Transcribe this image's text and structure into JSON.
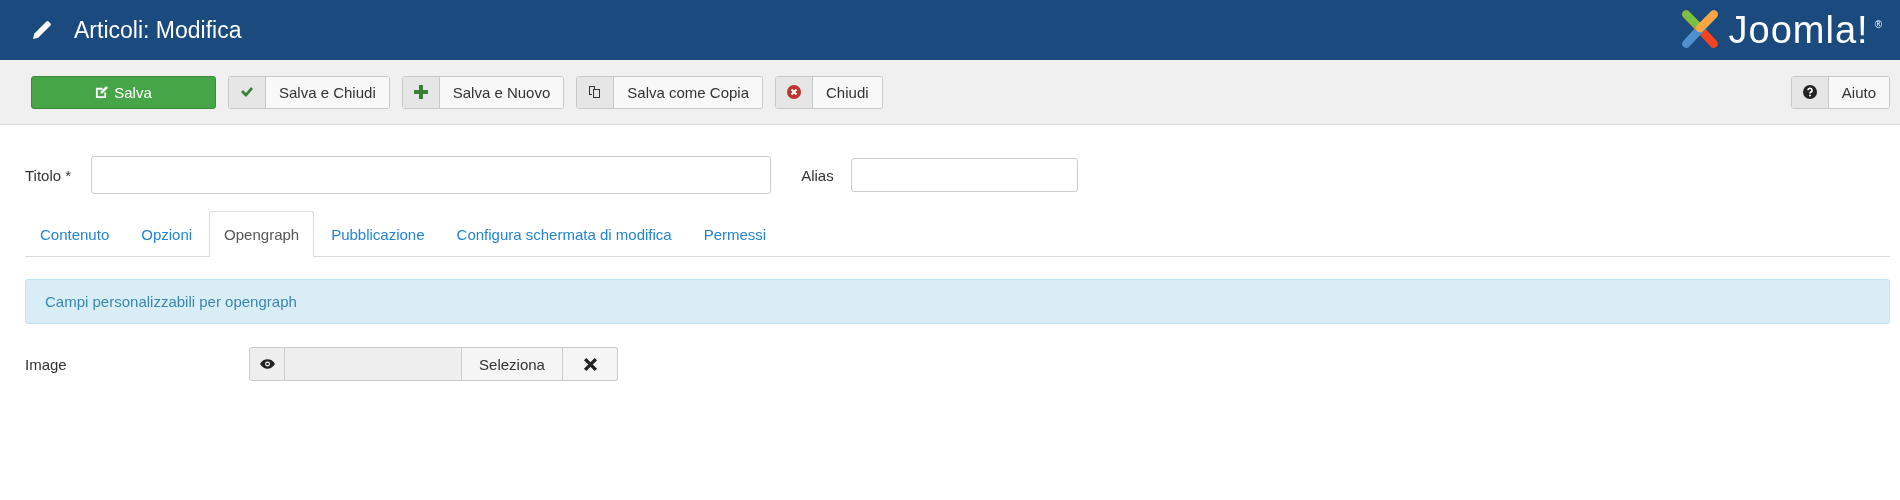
{
  "header": {
    "title": "Articoli: Modifica",
    "logo_text": "Joomla!",
    "logo_mark": "®"
  },
  "toolbar": {
    "buttons": [
      {
        "kind": "save",
        "label": "Salva"
      },
      {
        "kind": "save-close",
        "label": "Salva e Chiudi"
      },
      {
        "kind": "save-new",
        "label": "Salva e Nuovo"
      },
      {
        "kind": "save-copy",
        "label": "Salva come Copia"
      },
      {
        "kind": "close",
        "label": "Chiudi"
      }
    ],
    "help": {
      "kind": "help",
      "label": "Aiuto"
    }
  },
  "form": {
    "title_label": "Titolo *",
    "alias_label": "Alias"
  },
  "tabs": [
    {
      "label": "Contenuto",
      "selected": false
    },
    {
      "label": "Opzioni",
      "selected": false
    },
    {
      "label": "Opengraph",
      "selected": true
    },
    {
      "label": "Pubblicazione",
      "selected": false
    },
    {
      "label": "Configura schermata di modifica",
      "selected": false
    },
    {
      "label": "Permessi",
      "selected": false
    }
  ],
  "info": "Campi personalizzabili per opengraph",
  "image_field": {
    "label": "Image",
    "select_label": "Seleziona"
  }
}
